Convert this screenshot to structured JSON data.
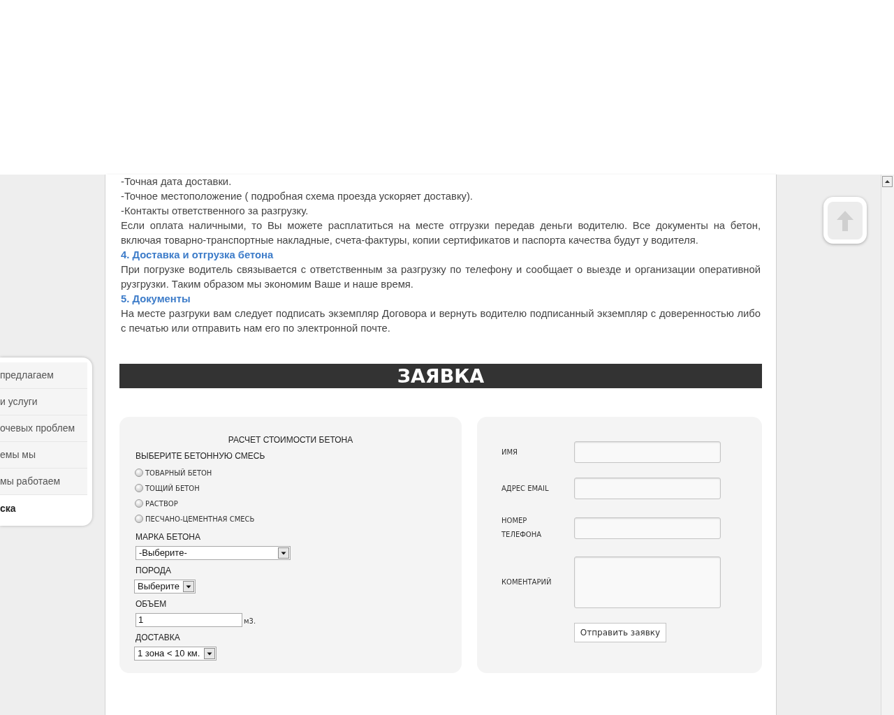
{
  "article": {
    "blocks": [
      {
        "kind": "text",
        "text": "-Точная дата доставки."
      },
      {
        "kind": "text",
        "text": "-Точное местоположение ( подробная схема проезда ускоряет доставку)."
      },
      {
        "kind": "text",
        "text": "-Контакты ответственного за разгрузку."
      },
      {
        "kind": "text",
        "text": "Если оплата наличными, то Вы можете расплатиться на месте отгрузки передав деньги водителю. Все документы на бетон, включая товарно-транспортные накладные, счета-фактуры, копии сертификатов и паспорта качества будут у водителя."
      },
      {
        "kind": "heading",
        "text": "4. Доставка и отгрузка бетона"
      },
      {
        "kind": "text",
        "text": "При погрузке водитель связывается с ответственным за разгрузку по телефону и сообщает о выезде и организации оперативной рузгрузки. Таким образом мы экономим Ваше и наше время."
      },
      {
        "kind": "heading",
        "text": "5. Документы"
      },
      {
        "kind": "text",
        "text": "На месте разгруки вам следует подписать экземпляр Договора и вернуть водителю подписанный экземпляр с доверенностью либо с печатью или отправить нам его по электронной почте."
      }
    ]
  },
  "sidebar": {
    "items": [
      {
        "label": "предлагаем",
        "selected": false
      },
      {
        "label": "и услуги",
        "selected": false
      },
      {
        "label": "очевых проблем",
        "selected": false
      },
      {
        "label": "емы мы",
        "selected": false
      },
      {
        "label": "мы работаем",
        "selected": false
      },
      {
        "label": "ска",
        "selected": true
      }
    ]
  },
  "order_banner": {
    "title": "ЗАЯВКА"
  },
  "calculator": {
    "title": "РАСЧЕТ СТОИМОСТИ БЕТОНА",
    "mix_label": "ВЫБЕРИТЕ БЕТОННУЮ СМЕСЬ",
    "mix_options": [
      {
        "label": "ТОВАРНЫЙ БЕТОН",
        "selected": false
      },
      {
        "label": "ТОЩИЙ БЕТОН",
        "selected": false
      },
      {
        "label": "РАСТВОР",
        "selected": false
      },
      {
        "label": "ПЕСЧАНО-ЦЕМЕНТНАЯ СМЕСЬ",
        "selected": false
      }
    ],
    "fields": [
      {
        "kind": "select",
        "label": "МАРКА БЕТОНА",
        "value": "-Выберите-"
      },
      {
        "kind": "select",
        "label": "ПОРОДА",
        "value": "Выберите"
      },
      {
        "kind": "input",
        "label": "ОБЪЕМ",
        "value": "1",
        "unit": "м3."
      },
      {
        "kind": "select",
        "label": "ДОСТАВКА",
        "value": "1 зона < 10 км."
      }
    ]
  },
  "contact_form": {
    "fields": [
      {
        "kind": "input",
        "label": "ИМЯ"
      },
      {
        "kind": "input",
        "label": "АДРЕС EMAIL"
      },
      {
        "kind": "input",
        "label": "НОМЕР ТЕЛЕФОНА"
      },
      {
        "kind": "textarea",
        "label": "КОМЕНТАРИЙ"
      }
    ],
    "submit": "Отправить заявку"
  }
}
